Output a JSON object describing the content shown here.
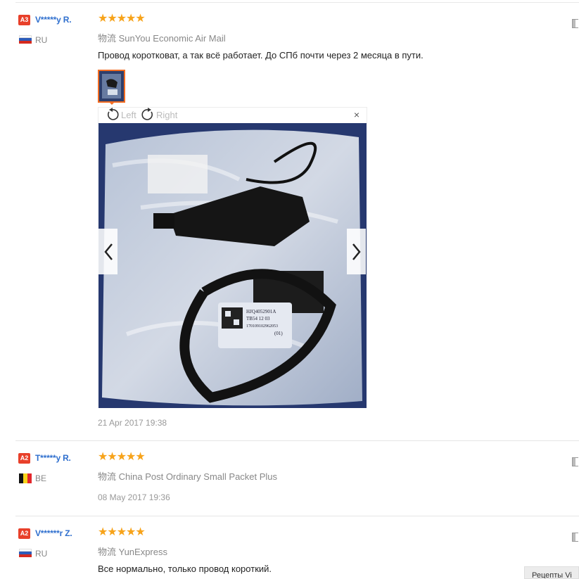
{
  "reviews": [
    {
      "level": "A3",
      "name": "V*****y R.",
      "country": "RU",
      "flag": "russia",
      "stars": "★★★★★",
      "shipping": "物流 SunYou Economic Air Mail",
      "feedback": "Провод коротковат, а так всё работает. До СПб почти через 2 месяца в пути.",
      "date": "21 Apr 2017 19:38"
    },
    {
      "level": "A2",
      "name": "T*****y R.",
      "country": "BE",
      "flag": "belgium",
      "stars": "★★★★★",
      "shipping": "物流 China Post Ordinary Small Packet Plus",
      "date": "08 May 2017 19:36"
    },
    {
      "level": "A2",
      "name": "V******r Z.",
      "country": "RU",
      "flag": "russia",
      "stars": "★★★★★",
      "shipping": "物流 YunExpress",
      "feedback": "Все нормально, только провод короткий."
    }
  ],
  "viewer": {
    "rotate_left": "Left",
    "rotate_right": "Right",
    "close": "×",
    "label_line1": "HJQ4052901A",
    "label_line2": "TB54 12 03",
    "label_line3": "170109102962053",
    "label_line4": "(01)"
  },
  "popup_button": "Рецепты Vi",
  "colors": {
    "accent_orange": "#f26c22",
    "star": "#f7a31a",
    "username": "#2f6fce",
    "level_badge": "#e8402a"
  }
}
